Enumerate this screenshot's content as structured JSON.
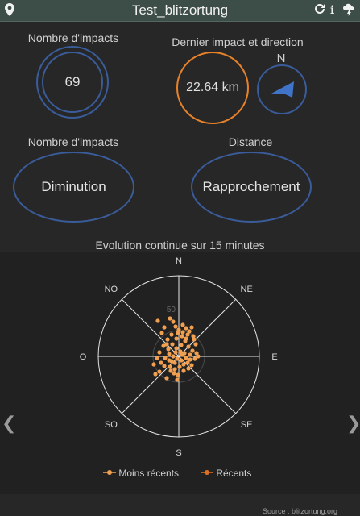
{
  "header": {
    "title": "Test_blitzortung",
    "location_icon": "location-pin-icon",
    "refresh_icon": "refresh-icon",
    "info_icon": "info-icon",
    "storm_icon": "thunderstorm-icon"
  },
  "impacts_count": {
    "label": "Nombre d'impacts",
    "value": "69"
  },
  "last_impact": {
    "label": "Dernier impact et direction",
    "distance": "22.64 km",
    "north": "N"
  },
  "trend_impacts": {
    "label": "Nombre d'impacts",
    "value": "Diminution"
  },
  "trend_distance": {
    "label": "Distance",
    "value": "Rapprochement"
  },
  "chart_section": {
    "title": "Evolution continue sur 15 minutes"
  },
  "chart_data": {
    "type": "scatter",
    "title": "Evolution continue sur 15 minutes",
    "directions": [
      "N",
      "NE",
      "E",
      "SE",
      "S",
      "SO",
      "O",
      "NO"
    ],
    "radial_tick": "50",
    "series": [
      {
        "name": "Moins récents",
        "color": "#f0a050",
        "points": [
          [
            -26,
            -44
          ],
          [
            -18,
            -36
          ],
          [
            -11,
            -47
          ],
          [
            -7,
            -43
          ],
          [
            -4,
            -37
          ],
          [
            0,
            -33
          ],
          [
            5,
            -39
          ],
          [
            9,
            -35
          ],
          [
            13,
            -31
          ],
          [
            16,
            -36
          ],
          [
            11,
            -27
          ],
          [
            4,
            -25
          ],
          [
            -3,
            -22
          ],
          [
            -9,
            -27
          ],
          [
            -14,
            -21
          ],
          [
            -19,
            -13
          ],
          [
            -13,
            -9
          ],
          [
            -8,
            -15
          ],
          [
            -3,
            -10
          ],
          [
            3,
            -14
          ],
          [
            8,
            -19
          ],
          [
            12,
            -12
          ],
          [
            17,
            -7
          ],
          [
            21,
            -15
          ],
          [
            14,
            -2
          ],
          [
            9,
            2
          ],
          [
            4,
            -2
          ],
          [
            -2,
            3
          ],
          [
            -7,
            0
          ],
          [
            -12,
            5
          ],
          [
            -17,
            2
          ],
          [
            -22,
            8
          ],
          [
            -27,
            2
          ],
          [
            -31,
            10
          ],
          [
            -18,
            12
          ],
          [
            -11,
            13
          ],
          [
            -5,
            16
          ],
          [
            1,
            13
          ],
          [
            6,
            10
          ],
          [
            11,
            8
          ],
          [
            16,
            11
          ],
          [
            20,
            3
          ],
          [
            24,
            0
          ],
          [
            -6,
            21
          ],
          [
            -24,
            19
          ],
          [
            -29,
            22
          ],
          [
            -15,
            27
          ],
          [
            -1,
            23
          ],
          [
            6,
            18
          ],
          [
            12,
            15
          ],
          [
            -9,
            6
          ],
          [
            2,
            -6
          ],
          [
            -4,
            -5
          ],
          [
            7,
            -4
          ],
          [
            -12,
            -3
          ],
          [
            18,
            -25
          ],
          [
            -21,
            -29
          ],
          [
            -1,
            -29
          ],
          [
            9,
            -22
          ],
          [
            -15,
            -15
          ],
          [
            22,
            -4
          ],
          [
            -5,
            8
          ],
          [
            3,
            5
          ],
          [
            -10,
            18
          ],
          [
            14,
            4
          ],
          [
            19,
            -21
          ],
          [
            -24,
            -5
          ],
          [
            5,
            -30
          ],
          [
            -2,
            29
          ]
        ]
      },
      {
        "name": "Récents",
        "color": "#e07020",
        "points": []
      }
    ]
  },
  "source": "Source : blitzortung.org"
}
